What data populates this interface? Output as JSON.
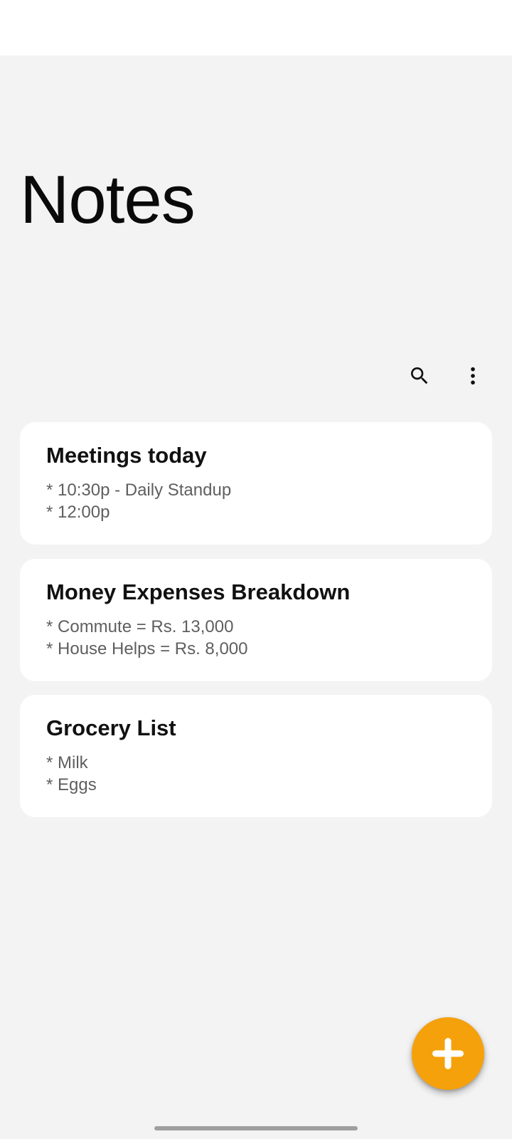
{
  "header": {
    "title": "Notes",
    "search_icon": "search-icon",
    "more_icon": "more-vertical-icon"
  },
  "notes": [
    {
      "title": "Meetings today",
      "lines": [
        "* 10:30p - Daily Standup",
        "* 12:00p"
      ]
    },
    {
      "title": "Money Expenses Breakdown",
      "lines": [
        "* Commute = Rs. 13,000",
        "* House Helps = Rs. 8,000"
      ]
    },
    {
      "title": "Grocery List",
      "lines": [
        "* Milk",
        "* Eggs"
      ]
    }
  ],
  "fab": {
    "icon": "plus-icon",
    "color": "#f5a10b"
  },
  "colors": {
    "background": "#f3f3f3",
    "card": "#ffffff",
    "accent": "#f5a10b"
  }
}
